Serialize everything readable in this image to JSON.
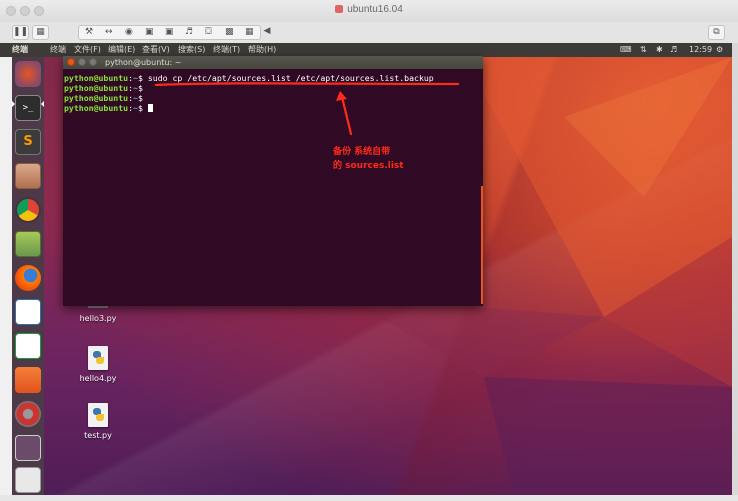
{
  "vm_window": {
    "title": "ubuntu16.04",
    "toolbar_icons": [
      "pause-icon",
      "snapshot-icon",
      "wrench-icon",
      "resize-icon",
      "disk-icon",
      "printer-icon",
      "printer-alt-icon",
      "speaker-icon",
      "usb-icon",
      "save-icon",
      "network-icon",
      "chevron-left-icon",
      "restore-window-icon"
    ]
  },
  "top_panel": {
    "app_name": "终端",
    "menus": [
      "终端",
      "文件(F)",
      "编辑(E)",
      "查看(V)",
      "搜索(S)",
      "终端(T)",
      "帮助(H)"
    ],
    "clock": "12:59"
  },
  "launcher": {
    "items": [
      "ubuntu-logo",
      "terminal",
      "sublime-text",
      "file-manager",
      "chrome",
      "archive-manager",
      "firefox",
      "libreoffice-writer",
      "libreoffice-calc",
      "ubuntu-software",
      "system-settings",
      "workspace-switcher",
      "printer"
    ]
  },
  "terminal": {
    "title": "python@ubuntu: ~",
    "lines": [
      {
        "user": "python@ubuntu",
        "sep": ":",
        "path": "~",
        "dollar": "$",
        "cmd": " sudo cp /etc/apt/sources.list /etc/apt/sources.list.backup"
      },
      {
        "user": "python@ubuntu",
        "sep": ":",
        "path": "~",
        "dollar": "$",
        "cmd": ""
      },
      {
        "user": "python@ubuntu",
        "sep": ":",
        "path": "~",
        "dollar": "$",
        "cmd": ""
      },
      {
        "user": "python@ubuntu",
        "sep": ":",
        "path": "~",
        "dollar": "$",
        "cmd": " "
      }
    ]
  },
  "annotation": {
    "line1": "备份 系统自带",
    "line2": "的 sources.list",
    "color": "#ff2a1a"
  },
  "desktop_icons": [
    {
      "label": "hello3.py"
    },
    {
      "label": "hello4.py"
    },
    {
      "label": "test.py"
    }
  ],
  "colors": {
    "terminal_bg": "#300a24",
    "prompt_user": "#8ae234",
    "prompt_path": "#729fcf",
    "panel_bg": "#3c3b37",
    "accent": "#e95420"
  }
}
